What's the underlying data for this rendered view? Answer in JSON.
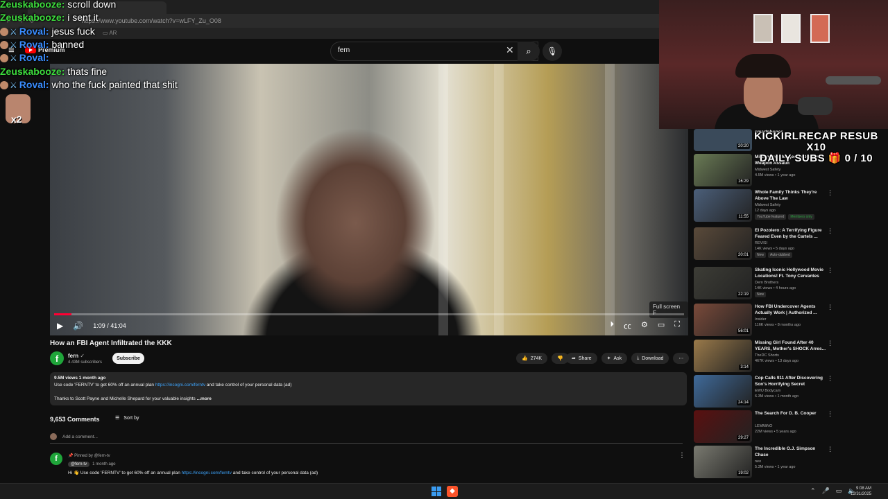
{
  "browser": {
    "url": "https://www.youtube.com/watch?v=wLFY_Zu_O08",
    "bookmark_folder": "AR"
  },
  "yt_header": {
    "logo_text": "Premium",
    "search_value": "fern"
  },
  "player": {
    "time": "1:09 / 41:04",
    "progress_fraction": 0.028,
    "fullscreen_tooltip": "Full screen  F"
  },
  "video": {
    "title": "How an FBI Agent Infiltrated the KKK",
    "channel": "fern",
    "subscribers": "4.43M subscribers",
    "subscribe_label": "Subscribe",
    "likes": "274K",
    "share_label": "Share",
    "ask_label": "Ask",
    "download_label": "Download",
    "desc_stats": "9.5M views  1 month ago",
    "desc_line1_pre": "Use code 'FERNTV' to get 60% off an annual plan ",
    "desc_link": "https://incogni.com/ferntv",
    "desc_line1_post": " and take control of your personal data (ad)",
    "desc_line2": "Thanks to Scott Payne and Michelle Shepard for your valuable insights",
    "desc_more": "...more"
  },
  "comments": {
    "count": "9,653 Comments",
    "sort_label": "Sort by",
    "add_placeholder": "Add a comment...",
    "pinned_label": "Pinned by @fern-tv",
    "handle": "@fern-tv",
    "time": "1 month ago",
    "text_pre": "Hi 👋 Use code 'FERNTV' to get 60% off an annual plan ",
    "text_link": "https://incogni.com/ferntv",
    "text_post": " and take control of your personal data (ad)"
  },
  "sidebar": [
    {
      "title": "Millionaire Charged in Deadly Weapon Assault",
      "channel": "Midwest Safety",
      "stats": "4.5M views • 1 year ago",
      "duration": "16:29",
      "badges": [],
      "color": "#6a7b55"
    },
    {
      "title": "Whole Family Thinks They're Above The Law",
      "channel": "Midwest Safety",
      "stats": "12 days ago",
      "duration": "11:55",
      "badges": [
        "YouTube featured",
        "Members only"
      ],
      "color": "#4b5f7a"
    },
    {
      "title": "El Pozolero: A Terrifying Figure Feared Even by the Cartels ...",
      "channel": "REVISI",
      "stats": "14K views • 5 days ago",
      "duration": "20:01",
      "badges": [
        "New",
        "Auto-dubbed"
      ],
      "color": "#5a4a3a"
    },
    {
      "title": "Skating Iconic Hollywood Movie Locations! Ft. Tony Cervantes",
      "channel": "Dern Brothers",
      "stats": "14K views • 4 hours ago",
      "duration": "22:19",
      "badges": [
        "New"
      ],
      "color": "#3d3d36"
    },
    {
      "title": "How FBI Undercover Agents Actually Work | Authorized ...",
      "channel": "Insider",
      "stats": "116K views • 8 months ago",
      "duration": "56:01",
      "badges": [],
      "color": "#7a4a3a"
    },
    {
      "title": "Missing Girl Found After 40 YEARS, Mother's SHOCK Arres...",
      "channel": "TheDC Shorts",
      "stats": "467K views • 13 days ago",
      "duration": "3:14",
      "badges": [],
      "color": "#9a7a4a"
    },
    {
      "title": "Cop Calls 911 After Discovering Son's Horrifying Secret",
      "channel": "EWU Bodycam",
      "stats": "6.3M views • 1 month ago",
      "duration": "24:14",
      "badges": [],
      "color": "#3f6a9a"
    },
    {
      "title": "The Search For D. B. Cooper",
      "channel": "LEMMiNO",
      "stats": "22M views • 5 years ago",
      "duration": "29:27",
      "badges": [],
      "color": "#5a1010"
    },
    {
      "title": "The Incredible O.J. Simpson Chase",
      "channel": "neo",
      "stats": "5.3M views • 1 year ago",
      "duration": "19:02",
      "badges": [],
      "color": "#7a7a70"
    }
  ],
  "sidebar_top": {
    "text": "smartphones",
    "duration": "20:20"
  },
  "overlay": {
    "kick_line1": "KICKIRLRECAP RESUB X10",
    "kick_line2": "DAILY SUBS 🎁 0 / 10"
  },
  "chat": [
    {
      "user": "Zeuskabooze",
      "msg": " scroll down",
      "style": "green"
    },
    {
      "user": "Zeuskabooze",
      "msg": " i sent it",
      "style": "green"
    },
    {
      "user": "Roval",
      "msg": " jesus fuck",
      "style": "blue"
    },
    {
      "user": "Roval",
      "msg": " banned",
      "style": "blue"
    },
    {
      "user": "Roval",
      "msg": "",
      "style": "blue"
    },
    {
      "user": "Zeuskabooze",
      "msg": " thats fine",
      "style": "green"
    },
    {
      "user": "Roval",
      "msg": " who the fuck painted that shit",
      "style": "blue"
    }
  ],
  "emote_count": "x2",
  "taskbar": {
    "time": "9:08 AM",
    "date": "12/31/2025"
  },
  "colors": {
    "yt_red": "#ff0033",
    "link_blue": "#3ea6ff",
    "chat_green": "#3ddc3d",
    "chat_blue": "#3a8dff"
  }
}
